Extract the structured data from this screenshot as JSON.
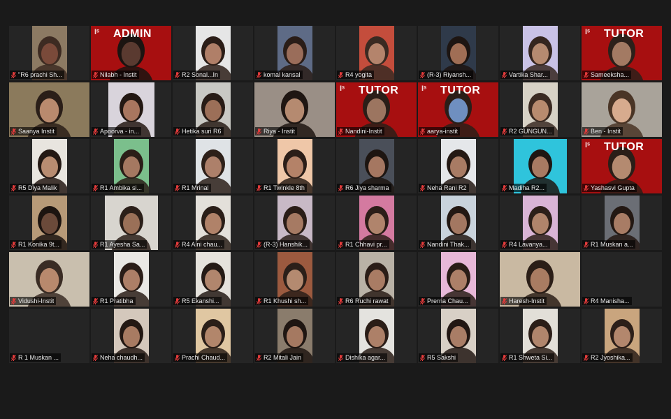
{
  "meeting": {
    "view": "gallery",
    "active_speaker_index": 1,
    "colors": {
      "background": "#1a1a1a",
      "tile": "#252525",
      "banner_red": "#a70f10",
      "active_border": "#cfd44a",
      "muted_mic": "#e23b3b"
    }
  },
  "participants": [
    {
      "name": "\"R6 prachi Sh...",
      "muted": true,
      "banner": "",
      "video": "w-half",
      "palette": [
        "#8c7a63",
        "#7a4a3a",
        "#3d2b22"
      ]
    },
    {
      "name": "Nilabh - Instit",
      "muted": true,
      "banner": "ADMIN",
      "video": "bg-red",
      "palette": [
        "#a70f10",
        "#5a3a30",
        "#1b1411"
      ]
    },
    {
      "name": "R2 Sonal...In",
      "muted": true,
      "banner": "",
      "video": "w-half",
      "palette": [
        "#e6e6e6",
        "#b07f68",
        "#2b1d17"
      ]
    },
    {
      "name": "komal kansal",
      "muted": true,
      "banner": "",
      "video": "w-half",
      "palette": [
        "#5e6b86",
        "#9a6d5a",
        "#2a1d18"
      ]
    },
    {
      "name": "R4 yogita",
      "muted": true,
      "banner": "",
      "video": "w-half",
      "palette": [
        "#c44d3c",
        "#b4846c",
        "#3a2a22"
      ]
    },
    {
      "name": "(R-3) Riyansh...",
      "muted": true,
      "banner": "",
      "video": "w-half",
      "palette": [
        "#2f3a4a",
        "#a06e55",
        "#1d1512"
      ]
    },
    {
      "name": "Vartika Shar...",
      "muted": true,
      "banner": "",
      "video": "w-half",
      "palette": [
        "#c9c2e6",
        "#b58a70",
        "#35261f"
      ]
    },
    {
      "name": "Sameeksha...",
      "muted": true,
      "banner": "TUTOR",
      "video": "bg-red",
      "palette": [
        "#a70f10",
        "#a37a63",
        "#2c201a"
      ]
    },
    {
      "name": "Saanya Instit",
      "muted": true,
      "banner": "",
      "video": "w-full",
      "palette": [
        "#8b7a5c",
        "#b98a6e",
        "#2a1e18"
      ]
    },
    {
      "name": "Apoorva - in...",
      "muted": true,
      "banner": "",
      "video": "w-mid",
      "palette": [
        "#d9d4dc",
        "#a8765f",
        "#231813"
      ]
    },
    {
      "name": "Hetika suri R6",
      "muted": true,
      "banner": "",
      "video": "w-half",
      "palette": [
        "#c9c9c4",
        "#9c6f58",
        "#281c16"
      ]
    },
    {
      "name": "Riya - Instit",
      "muted": true,
      "banner": "",
      "video": "w-full",
      "palette": [
        "#9a8f86",
        "#b58a70",
        "#1f1612"
      ]
    },
    {
      "name": "Nandini-Instit",
      "muted": true,
      "banner": "TUTOR",
      "video": "bg-red",
      "palette": [
        "#a70f10",
        "#9c7560",
        "#2a1e18"
      ]
    },
    {
      "name": "aarya-instit",
      "muted": true,
      "banner": "TUTOR",
      "video": "bg-red",
      "palette": [
        "#a70f10",
        "#6f8fc0",
        "#2a1e18"
      ]
    },
    {
      "name": "R2 GUNGUN...",
      "muted": true,
      "banner": "",
      "video": "w-half",
      "palette": [
        "#d7d2c6",
        "#b88b6f",
        "#3a2a22"
      ]
    },
    {
      "name": "Ben - Instit",
      "muted": true,
      "banner": "",
      "video": "w-full",
      "palette": [
        "#a9a39a",
        "#d7ab8e",
        "#4a3526"
      ]
    },
    {
      "name": "R5 Diya Malik",
      "muted": true,
      "banner": "",
      "video": "w-half",
      "palette": [
        "#e8e5df",
        "#b88c71",
        "#241914"
      ]
    },
    {
      "name": "R1 Ambika si...",
      "muted": true,
      "banner": "",
      "video": "w-half",
      "palette": [
        "#7bbf8c",
        "#a57861",
        "#2a1d17"
      ]
    },
    {
      "name": "R1 Mrinal",
      "muted": true,
      "banner": "",
      "video": "w-half",
      "palette": [
        "#dfe3e6",
        "#ad806a",
        "#2d2019"
      ]
    },
    {
      "name": "R1 Twinkle 8th",
      "muted": true,
      "banner": "",
      "video": "w-half",
      "palette": [
        "#efc7a8",
        "#b48268",
        "#2b1e18"
      ]
    },
    {
      "name": "R6 Jiya sharma",
      "muted": true,
      "banner": "",
      "video": "w-half",
      "palette": [
        "#4a4f59",
        "#a57761",
        "#1d1511"
      ]
    },
    {
      "name": "Neha Rani R2",
      "muted": true,
      "banner": "",
      "video": "w-half",
      "palette": [
        "#e5e7ea",
        "#a87b64",
        "#241914"
      ]
    },
    {
      "name": "Madiha R2...",
      "muted": true,
      "banner": "",
      "video": "w-wide",
      "palette": [
        "#2fc4dc",
        "#a87a62",
        "#1f1612"
      ]
    },
    {
      "name": "Yashasvi Gupta",
      "muted": true,
      "banner": "TUTOR",
      "video": "bg-red",
      "palette": [
        "#a70f10",
        "#b48a70",
        "#2a1e18"
      ]
    },
    {
      "name": "R1 Konika 9t...",
      "muted": true,
      "banner": "",
      "video": "w-half",
      "palette": [
        "#b79a78",
        "#6b4a3a",
        "#1c1410"
      ]
    },
    {
      "name": "R1 Ayesha Sa...",
      "muted": true,
      "banner": "",
      "video": "w-wide",
      "palette": [
        "#d8d5cf",
        "#9a7058",
        "#2b1f19"
      ]
    },
    {
      "name": "R4 Aini chau...",
      "muted": true,
      "banner": "",
      "video": "w-half",
      "palette": [
        "#e3e0da",
        "#b08269",
        "#2a1e18"
      ]
    },
    {
      "name": "(R-3) Hanshik...",
      "muted": true,
      "banner": "",
      "video": "w-half",
      "palette": [
        "#c8b9c6",
        "#a67a63",
        "#2a1d17"
      ]
    },
    {
      "name": "R1 Chhavi pr...",
      "muted": true,
      "banner": "",
      "video": "w-half",
      "palette": [
        "#d47aa0",
        "#b0846c",
        "#2b1e18"
      ]
    },
    {
      "name": "Nandini Thak...",
      "muted": true,
      "banner": "",
      "video": "w-half",
      "palette": [
        "#c9d3dc",
        "#a37761",
        "#231813"
      ]
    },
    {
      "name": "R4  Lavanya...",
      "muted": true,
      "banner": "",
      "video": "w-half",
      "palette": [
        "#d9b4d6",
        "#b0846b",
        "#2c1f19"
      ]
    },
    {
      "name": "R1 Muskan a...",
      "muted": true,
      "banner": "",
      "video": "w-half",
      "palette": [
        "#6b6e75",
        "#a87c65",
        "#231813"
      ]
    },
    {
      "name": "Vidushi-Instit",
      "muted": true,
      "banner": "",
      "video": "w-full",
      "palette": [
        "#c9bfae",
        "#b8896d",
        "#3a2c24"
      ]
    },
    {
      "name": "R1 Pratibha",
      "muted": true,
      "banner": "",
      "video": "w-half",
      "palette": [
        "#e9e8e4",
        "#ad7f67",
        "#2a1d17"
      ]
    },
    {
      "name": "R5 Ekanshi...",
      "muted": true,
      "banner": "",
      "video": "w-half",
      "palette": [
        "#e5e2dc",
        "#b1866d",
        "#241a15"
      ]
    },
    {
      "name": "R1  Khushi sh...",
      "muted": true,
      "banner": "",
      "video": "w-half",
      "palette": [
        "#9c5a3f",
        "#b48a70",
        "#2b1f19"
      ]
    },
    {
      "name": "R6 Ruchi rawat",
      "muted": true,
      "banner": "",
      "video": "w-half",
      "palette": [
        "#b9b2a6",
        "#a97c64",
        "#2a1d17"
      ]
    },
    {
      "name": "Prerna Chau...",
      "muted": true,
      "banner": "",
      "video": "w-half",
      "palette": [
        "#e7b8d8",
        "#ad8068",
        "#291d17"
      ]
    },
    {
      "name": "Haresh-Instit",
      "muted": true,
      "banner": "",
      "video": "w-full",
      "palette": [
        "#c9b9a2",
        "#a97c62",
        "#2b1e17"
      ]
    },
    {
      "name": "R4 Manisha...",
      "muted": true,
      "banner": "",
      "video": "none",
      "palette": [
        "#252525",
        "#252525",
        "#252525"
      ]
    },
    {
      "name": "R 1 Muskan ...",
      "muted": true,
      "banner": "",
      "video": "none",
      "palette": [
        "#252525",
        "#252525",
        "#252525"
      ]
    },
    {
      "name": "Neha chaudh...",
      "muted": true,
      "banner": "",
      "video": "w-half",
      "palette": [
        "#d4c8bc",
        "#a87b62",
        "#231813"
      ]
    },
    {
      "name": "Prachi Chaud...",
      "muted": true,
      "banner": "",
      "video": "w-half",
      "palette": [
        "#e0c7a2",
        "#b2866b",
        "#2a1e18"
      ]
    },
    {
      "name": "R2 Mitali Jain",
      "muted": true,
      "banner": "",
      "video": "w-half",
      "palette": [
        "#8a7c6c",
        "#a57961",
        "#1f1612"
      ]
    },
    {
      "name": "Dishika agar...",
      "muted": true,
      "banner": "",
      "video": "w-half",
      "palette": [
        "#e4e3df",
        "#ad8068",
        "#2a1d17"
      ]
    },
    {
      "name": "R5 Sakshi",
      "muted": true,
      "banner": "",
      "video": "w-half",
      "palette": [
        "#d8d0c6",
        "#a97d66",
        "#221713"
      ]
    },
    {
      "name": "R1 Shweta Si...",
      "muted": true,
      "banner": "",
      "video": "w-half",
      "palette": [
        "#e2dfd8",
        "#b0856c",
        "#2b1e18"
      ]
    },
    {
      "name": "R2  Jyoshika...",
      "muted": true,
      "banner": "",
      "video": "w-half",
      "palette": [
        "#c9a57e",
        "#b3876d",
        "#2c1f19"
      ]
    }
  ]
}
